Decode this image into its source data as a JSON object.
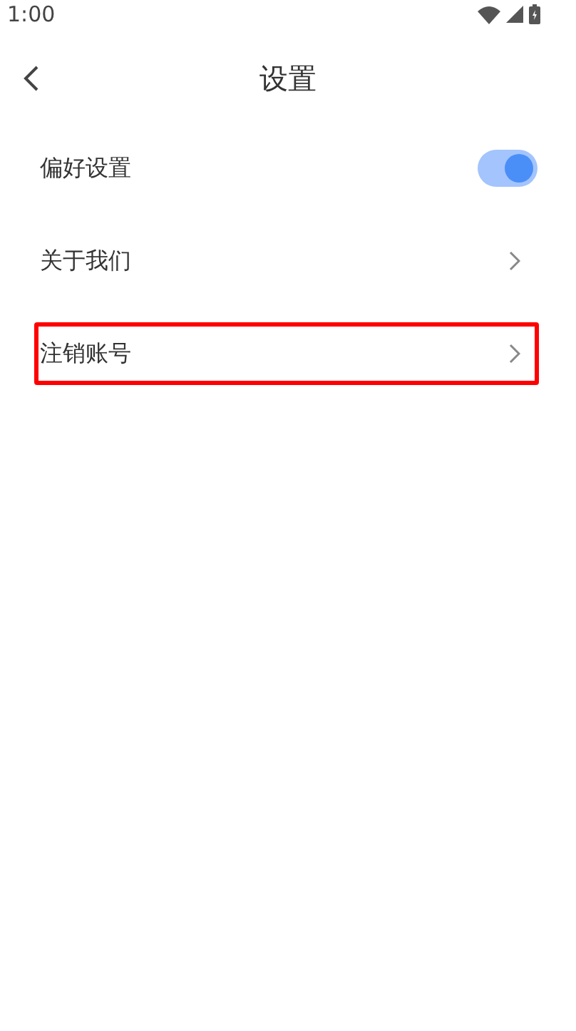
{
  "status_bar": {
    "time": "1:00"
  },
  "header": {
    "title": "设置"
  },
  "items": [
    {
      "label": "偏好设置",
      "kind": "toggle",
      "on": true,
      "highlighted": false
    },
    {
      "label": "关于我们",
      "kind": "link",
      "highlighted": false
    },
    {
      "label": "注销账号",
      "kind": "link",
      "highlighted": true
    }
  ]
}
